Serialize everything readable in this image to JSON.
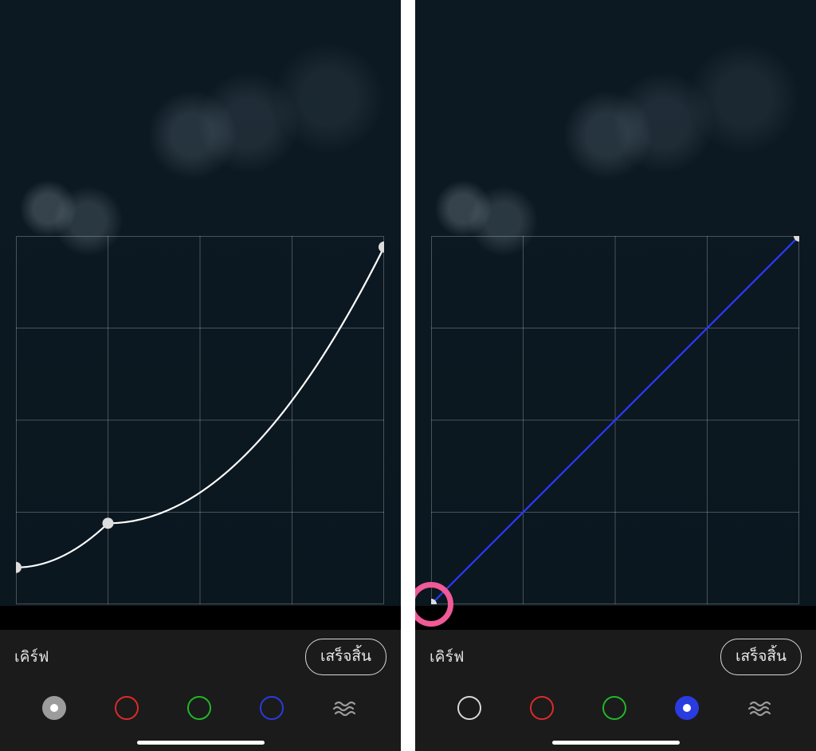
{
  "left": {
    "title": "เคิร์ฟ",
    "done": "เสร็จสิ้น",
    "selected_channel": "luminance",
    "channels": [
      {
        "id": "luminance",
        "ring": "#9c9c9c",
        "fill": "#9c9c9c",
        "dot": true
      },
      {
        "id": "red",
        "ring": "#e02a2a"
      },
      {
        "id": "green",
        "ring": "#1fb82a"
      },
      {
        "id": "blue",
        "ring": "#2a3be0"
      },
      {
        "id": "waves",
        "ring": "#9c9c9c"
      }
    ],
    "curve": {
      "color": "#ffffff",
      "points": [
        {
          "x": 0.0,
          "y": 0.1
        },
        {
          "x": 0.25,
          "y": 0.22
        },
        {
          "x": 1.0,
          "y": 0.97
        }
      ]
    }
  },
  "right": {
    "title": "เคิร์ฟ",
    "done": "เสร็จสิ้น",
    "selected_channel": "blue",
    "channels": [
      {
        "id": "luminance",
        "ring": "#d8d8d8"
      },
      {
        "id": "red",
        "ring": "#e02a2a"
      },
      {
        "id": "green",
        "ring": "#1fb82a"
      },
      {
        "id": "blue",
        "ring": "#2a3be0",
        "fill": "#2a3be0",
        "dot": true
      },
      {
        "id": "waves",
        "ring": "#9c9c9c"
      }
    ],
    "curve": {
      "color": "#2a3bff",
      "points": [
        {
          "x": 0.0,
          "y": 0.0
        },
        {
          "x": 1.0,
          "y": 1.0
        }
      ]
    },
    "highlight_point_index": 0
  }
}
